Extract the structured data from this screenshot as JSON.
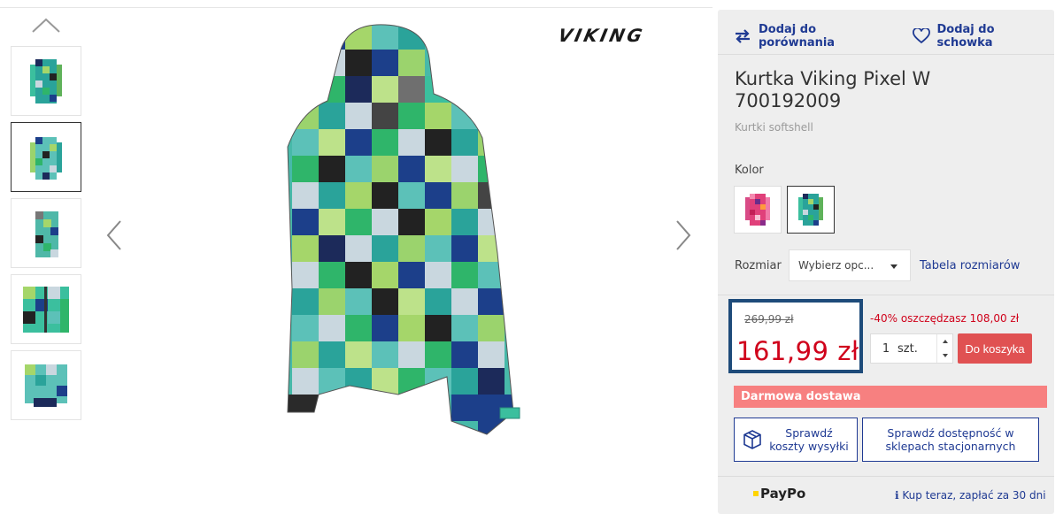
{
  "gallery": {
    "thumbnails": [
      "thumb-front",
      "thumb-back",
      "thumb-side",
      "thumb-detail-zip",
      "thumb-detail-sleeve"
    ],
    "active_index": 1
  },
  "brand": {
    "logo_text": "VIKING"
  },
  "panel": {
    "compare_label": "Dodaj do porównania",
    "wishlist_label": "Dodaj do schowka",
    "title": "Kurtka Viking Pixel W 700192009",
    "category": "Kurtki softshell",
    "color_label": "Kolor",
    "size_label": "Rozmiar",
    "size_placeholder": "Wybierz opc...",
    "size_table_label": "Tabela rozmiarów",
    "old_price": "269,99 zł",
    "new_price": "161,99 zł",
    "discount_text": "-40% oszczędzasz 108,00 zł",
    "quantity": "1",
    "quantity_unit": "szt.",
    "add_to_cart_label": "Do koszyka",
    "free_shipping_label": "Darmowa dostawa",
    "check_shipping_label": "Sprawdź koszty wysyłki",
    "check_store_label": "Sprawdź dostępność w sklepach stacjonarnych",
    "paypo_label": "PayPo",
    "paypo_info": "Kup teraz, zapłać za 30 dni"
  },
  "colors": {
    "accent": "#1f3a93",
    "price": "#d0021b",
    "cart": "#e05152",
    "free_ship": "#f78080",
    "price_border": "#1e4b7a"
  }
}
